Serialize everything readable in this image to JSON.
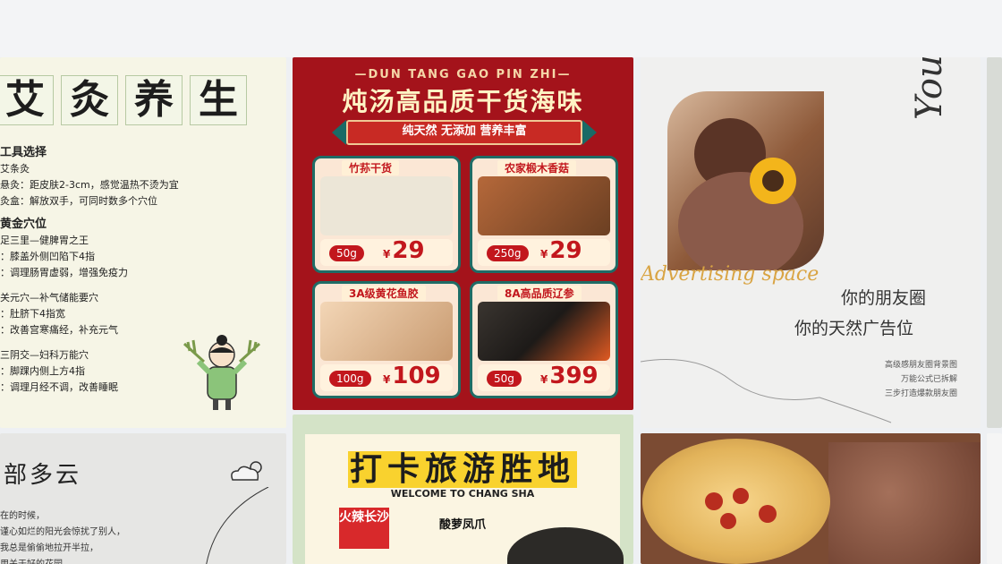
{
  "card1": {
    "title_chars": [
      "艾",
      "灸",
      "养",
      "生"
    ],
    "lines": [
      {
        "text": "工具选择",
        "type": "hd"
      },
      {
        "text": "艾条灸",
        "type": "n"
      },
      {
        "text": "悬灸：距皮肤2-3cm，感觉温热不烫为宜",
        "type": "n"
      },
      {
        "text": "灸盒：解放双手，可同时数多个穴位",
        "type": "n"
      },
      {
        "text": "黄金穴位",
        "type": "hd"
      },
      {
        "text": "足三里—健脾胃之王",
        "type": "n"
      },
      {
        "text": "：膝盖外侧凹陷下4指",
        "type": "n"
      },
      {
        "text": "：调理肠胃虚弱，增强免疫力",
        "type": "n"
      },
      {
        "text": "关元穴—补气储能要穴",
        "type": "n"
      },
      {
        "text": "：肚脐下4指宽",
        "type": "n"
      },
      {
        "text": "：改善宫寒痛经，补充元气",
        "type": "n"
      },
      {
        "text": "三阴交—妇科万能穴",
        "type": "n"
      },
      {
        "text": "：脚踝内侧上方4指",
        "type": "n"
      },
      {
        "text": "：调理月经不调，改善睡眠",
        "type": "n"
      }
    ]
  },
  "card2": {
    "top": "—DUN TANG GAO PIN ZHI—",
    "title": "炖汤高品质干货海味",
    "ribbon": "纯天然 无添加 营养丰富",
    "products": [
      {
        "label": "竹荪干货",
        "weight": "50g",
        "price": "29",
        "currency": "¥",
        "color": "#f4f1ea"
      },
      {
        "label": "农家椴木香菇",
        "weight": "250g",
        "price": "29",
        "currency": "¥",
        "color": "#8a5a32"
      },
      {
        "label": "3A级黄花鱼胶",
        "weight": "100g",
        "price": "109",
        "currency": "¥",
        "color": "#f6d8b6"
      },
      {
        "label": "8A高品质辽参",
        "weight": "50g",
        "price": "399",
        "currency": "¥",
        "color": "#2d2b29"
      }
    ]
  },
  "card3": {
    "yours": "Yours",
    "adv": "Advertising space",
    "line1": "你的朋友圈",
    "line2": "你的天然广告位",
    "small": [
      "高级感朋友圈背景图",
      "万能公式已拆解",
      "三步打造爆款朋友圈"
    ]
  },
  "card5": {
    "title": "部多云",
    "lines": [
      "在的时候，",
      "谨心如烂的阳光会惊扰了别人，",
      "我总是偷偷地拉开半拉，",
      "用关于好的花园"
    ]
  },
  "card6": {
    "title": "打卡旅游胜地",
    "sub": "WELCOME TO CHANG SHA",
    "badge": "火辣长沙",
    "tag": "酸萝凤爪"
  }
}
